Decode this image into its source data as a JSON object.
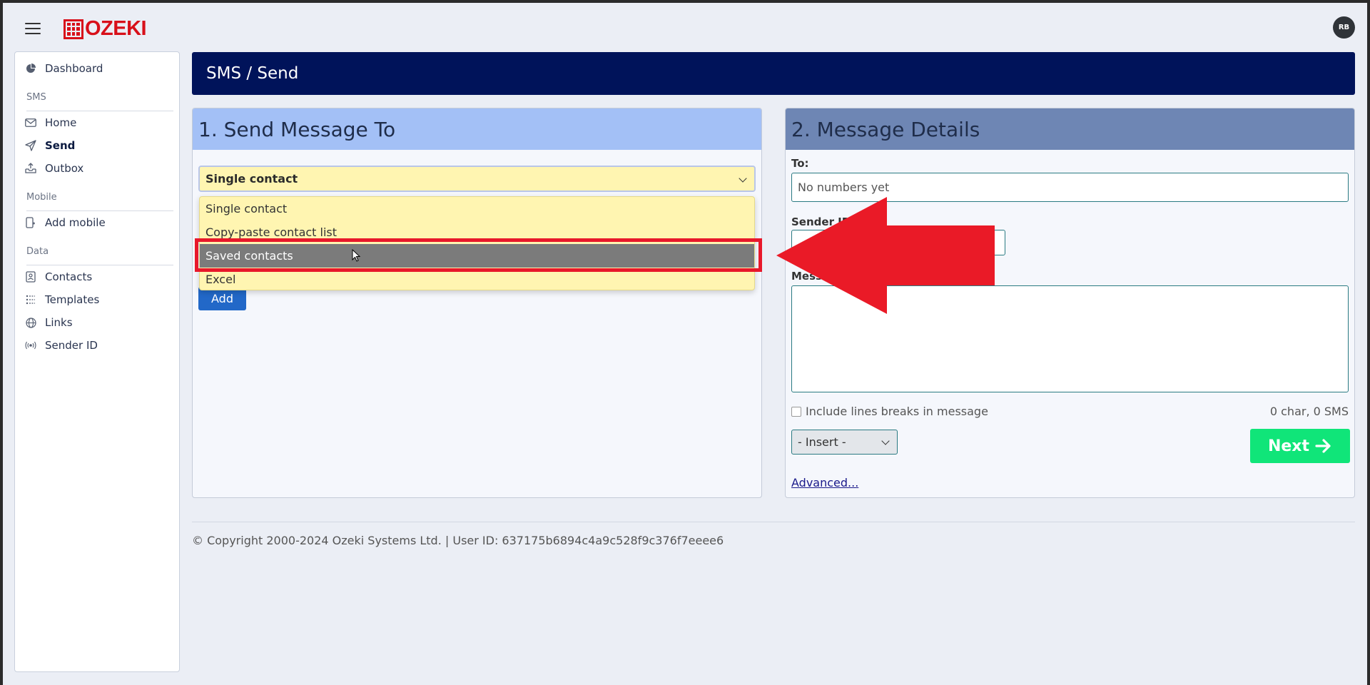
{
  "topbar": {
    "logo_text": "OZEKI",
    "avatar_initials": "RB"
  },
  "sidebar": {
    "dashboard": "Dashboard",
    "section_sms": "SMS",
    "home": "Home",
    "send": "Send",
    "outbox": "Outbox",
    "section_mobile": "Mobile",
    "add_mobile": "Add mobile",
    "section_data": "Data",
    "contacts": "Contacts",
    "templates": "Templates",
    "links": "Links",
    "sender_id": "Sender ID"
  },
  "header": {
    "title": "SMS / Send"
  },
  "left_panel": {
    "title": "1. Send Message To",
    "selected_value": "Single contact",
    "options": [
      "Single contact",
      "Copy-paste contact list",
      "Saved contacts",
      "Excel"
    ],
    "highlighted_option": "Saved contacts",
    "add_label": "Add"
  },
  "right_panel": {
    "title": "2. Message Details",
    "to_label": "To:",
    "to_placeholder": "No numbers yet",
    "sender_label": "Sender ID",
    "message_label": "Message",
    "line_breaks_label": "Include lines breaks in message",
    "counter": "0 char, 0 SMS",
    "insert_label": "- Insert -",
    "next_label": "Next",
    "advanced_label": "Advanced..."
  },
  "footer": {
    "text": "© Copyright 2000-2024 Ozeki Systems Ltd. | User ID: 637175b6894c4a9c528f9c376f7eeee6"
  },
  "colors": {
    "header_bg": "#00135a",
    "left_head_bg": "#a3c0f6",
    "right_head_bg": "#6e86b4",
    "select_bg": "#fff5b1",
    "highlight": "#e8182a",
    "next_button": "#10e579",
    "brand_red": "#d8101a"
  }
}
